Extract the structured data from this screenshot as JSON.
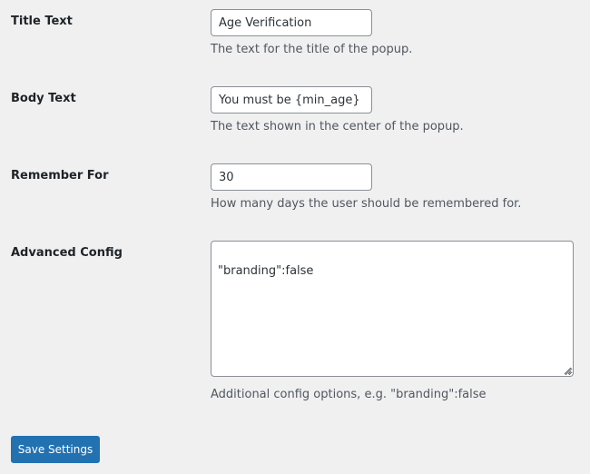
{
  "settings": {
    "title_text": {
      "label": "Title Text",
      "value": "Age Verification",
      "description": "The text for the title of the popup."
    },
    "body_text": {
      "label": "Body Text",
      "value": "You must be {min_age} or",
      "description": "The text shown in the center of the popup."
    },
    "remember_for": {
      "label": "Remember For",
      "value": "30",
      "description": "How many days the user should be remembered for."
    },
    "advanced_config": {
      "label": "Advanced Config",
      "value": "\"branding\":false",
      "description": "Additional config options, e.g. \"branding\":false"
    }
  },
  "actions": {
    "save_label": "Save Settings"
  },
  "colors": {
    "background": "#f0f0f1",
    "primary_button": "#2271b1",
    "input_border": "#8c8f94",
    "description_text": "#50575e"
  }
}
